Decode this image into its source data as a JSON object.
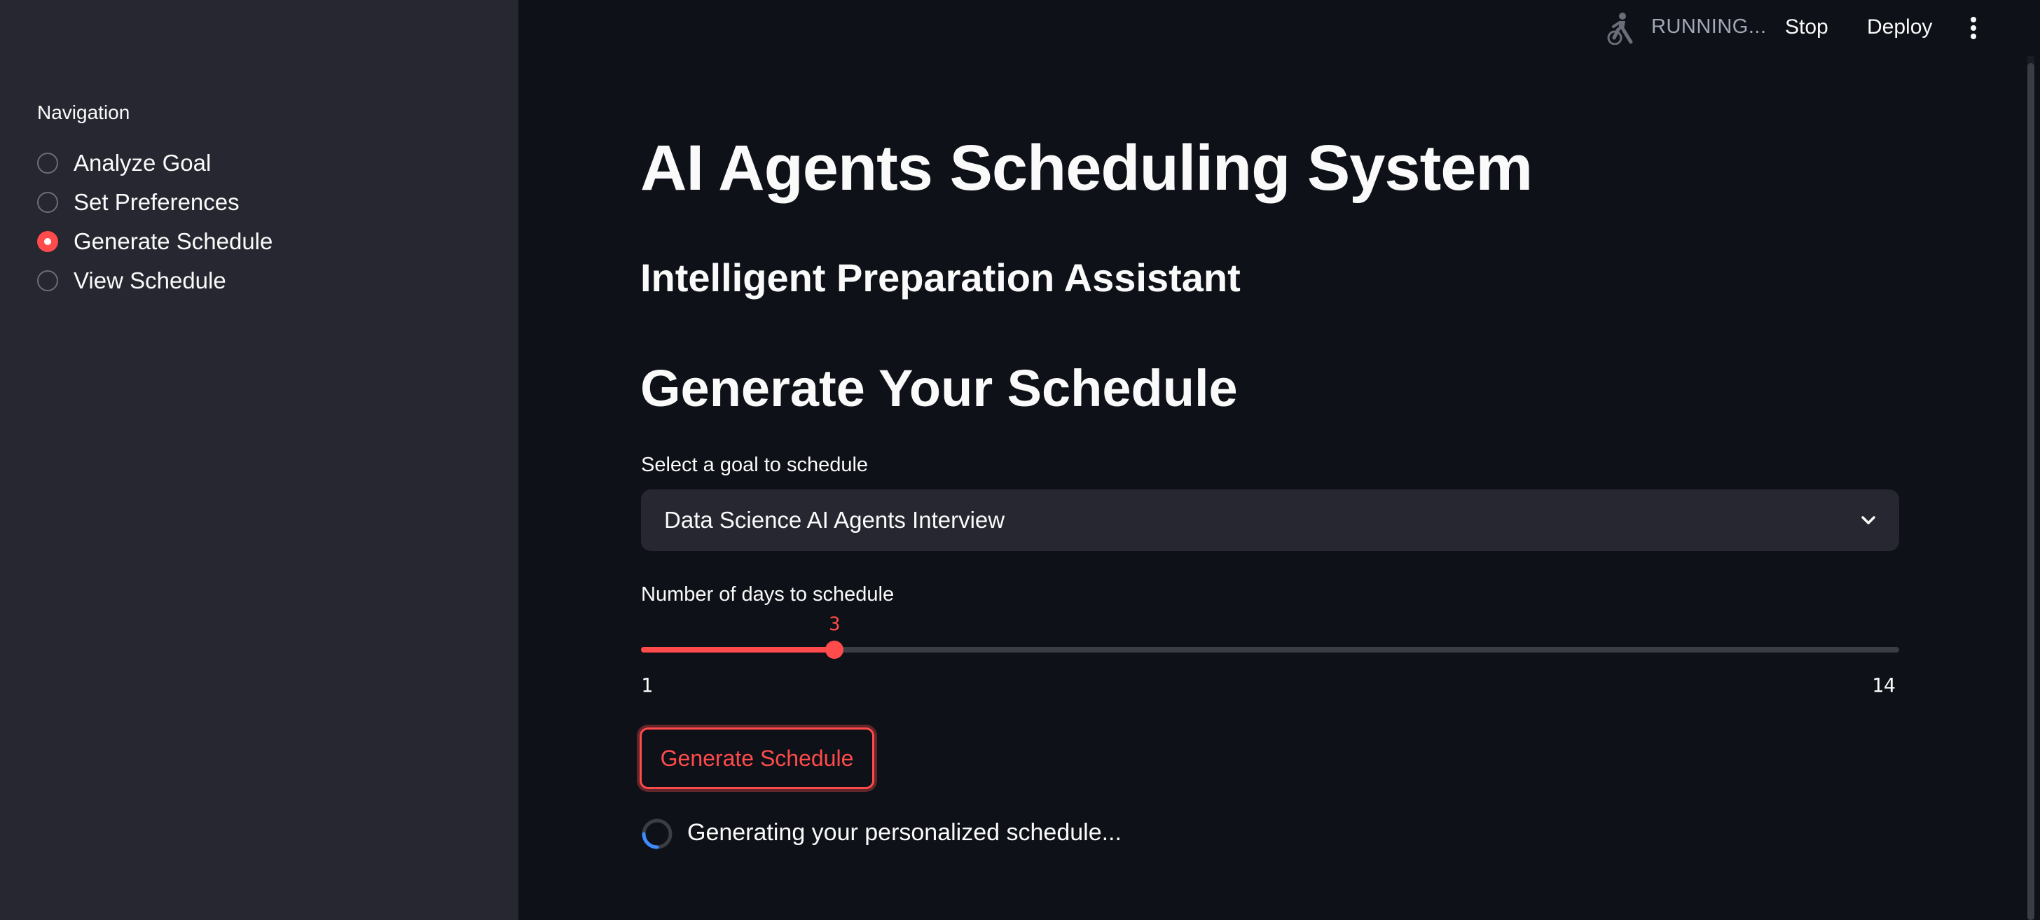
{
  "sidebar": {
    "nav_label": "Navigation",
    "items": [
      {
        "label": "Analyze Goal",
        "selected": false
      },
      {
        "label": "Set Preferences",
        "selected": false
      },
      {
        "label": "Generate Schedule",
        "selected": true
      },
      {
        "label": "View Schedule",
        "selected": false
      }
    ]
  },
  "header": {
    "status": "RUNNING...",
    "stop_label": "Stop",
    "deploy_label": "Deploy",
    "status_icon": "running-person-icon",
    "menu_icon": "kebab-menu-icon"
  },
  "main": {
    "title": "AI Agents Scheduling System",
    "subtitle": "Intelligent Preparation Assistant",
    "section_title": "Generate Your Schedule",
    "goal_select": {
      "label": "Select a goal to schedule",
      "value": "Data Science AI Agents Interview"
    },
    "days_slider": {
      "label": "Number of days to schedule",
      "value": 3,
      "value_text": "3",
      "min": 1,
      "max": 14,
      "min_text": "1",
      "max_text": "14"
    },
    "generate_button": "Generate Schedule",
    "spinner_text": "Generating your personalized schedule..."
  },
  "colors": {
    "background": "#0e1117",
    "sidebar": "#262730",
    "accent": "#ff4b4b",
    "text": "#fafafa",
    "muted": "#a3a8b8"
  }
}
